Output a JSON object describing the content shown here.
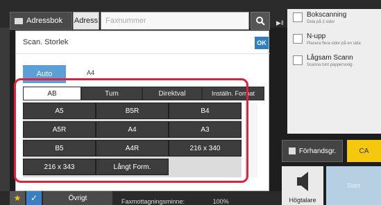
{
  "toolbar": {
    "addressbook_label": "Adressbok",
    "address_label": "Adress",
    "fax_placeholder": "Faxnummer"
  },
  "options": [
    {
      "title": "Bokscanning",
      "subtitle": "Dela på 2 sidor"
    },
    {
      "title": "N-upp",
      "subtitle": "Placera flera sidor på en sida"
    },
    {
      "title": "Lågsam Scann",
      "subtitle": "Scanna tunt pappersorig."
    }
  ],
  "actions": {
    "preview_label": "Förhandsgr.",
    "ca_label": "CA",
    "speaker_label": "Högtalare",
    "start_label": "Start"
  },
  "dialog": {
    "title": "Scan. Storlek",
    "ok_label": "OK",
    "auto_label": "Auto",
    "auto_value": "A4",
    "tabs": [
      "AB",
      "Tum",
      "Direktval",
      "Inställn. Format"
    ],
    "active_tab": "AB",
    "sizes": [
      "A5",
      "B5R",
      "B4",
      "A5R",
      "A4",
      "A3",
      "B5",
      "A4R",
      "216 x 340",
      "216 x 343",
      "Långt Form."
    ]
  },
  "bottom": {
    "other_label": "Övrigt",
    "memory_text": "Faxmottagningsminne:",
    "memory_value": "100%"
  },
  "colors": {
    "accent_blue": "#2f7fc1",
    "auto_blue": "#5b9fd6",
    "highlight_red": "#e0203c",
    "ca_yellow": "#f4c80e"
  }
}
